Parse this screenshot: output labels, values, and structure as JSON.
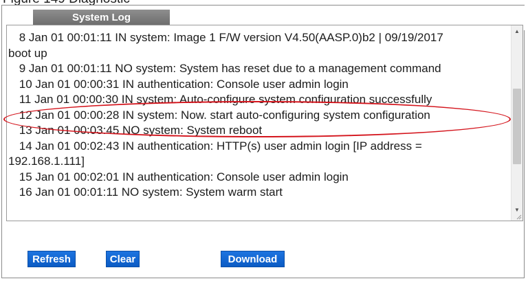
{
  "figure_caption_fragment": "Figure 149  Diagnostic",
  "panel": {
    "title": "System Log"
  },
  "log": {
    "lines": [
      {
        "text": " 8 Jan 01 00:01:11 IN system: Image 1 F/W version V4.50(AASP.0)b2 | 09/19/2017",
        "cont": "boot up"
      },
      {
        "text": " 9 Jan 01 00:01:11 NO system: System has reset due to a management command",
        "cont": ""
      },
      {
        "text": " 10 Jan 01 00:00:31 IN authentication: Console user admin login",
        "cont": ""
      },
      {
        "text": " 11 Jan 01 00:00:30 IN system: Auto-configure system configuration successfully",
        "cont": ""
      },
      {
        "text": " 12 Jan 01 00:00:28 IN system: Now. start auto-configuring system configuration",
        "cont": ""
      },
      {
        "text": " 13 Jan 01 00:03:45 NO system: System reboot",
        "cont": ""
      },
      {
        "text": " 14 Jan 01 00:02:43 IN authentication: HTTP(s) user admin login [IP address =",
        "cont": "192.168.1.111]"
      },
      {
        "text": " 15 Jan 01 00:02:01 IN authentication: Console user admin login",
        "cont": ""
      },
      {
        "text": " 16 Jan 01 00:01:11 NO system: System warm start",
        "cont": ""
      }
    ],
    "highlight_color": "#d4141c"
  },
  "buttons": {
    "refresh": "Refresh",
    "clear": "Clear",
    "download": "Download",
    "color": "#1565d8"
  },
  "icons": {
    "scroll_up": "scroll-up-arrow-icon",
    "scroll_down": "scroll-down-arrow-icon",
    "resize": "resize-grip-icon"
  }
}
